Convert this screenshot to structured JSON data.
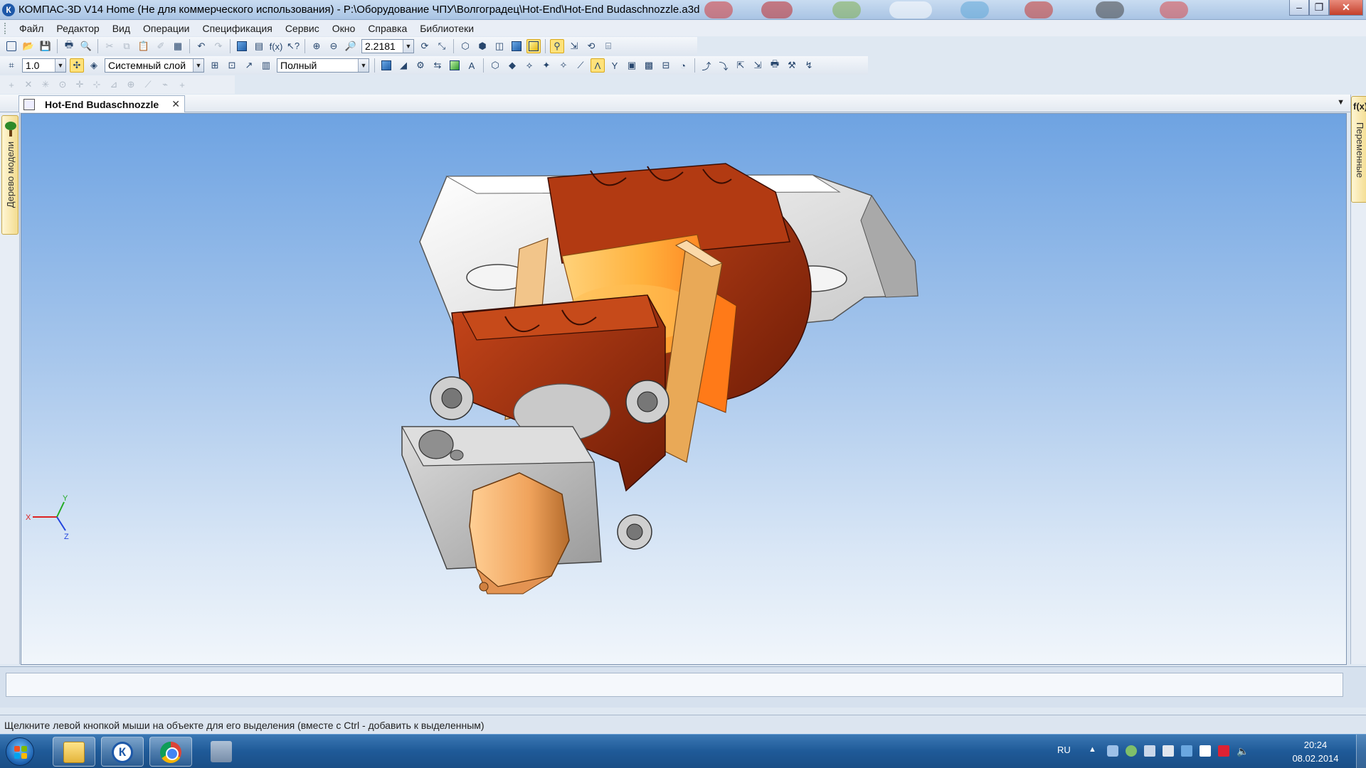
{
  "window": {
    "title": "КОМПАС-3D V14 Home (Не для коммерческого использования) - P:\\Оборудование ЧПУ\\Волгоградец\\Hot-End\\Hot-End Budaschnozzle.a3d",
    "app_icon_letter": "К"
  },
  "menu": [
    "Файл",
    "Редактор",
    "Вид",
    "Операции",
    "Спецификация",
    "Сервис",
    "Окно",
    "Справка",
    "Библиотеки"
  ],
  "toolbar1": {
    "zoom_value": "2.2181"
  },
  "toolbar2": {
    "step_value": "1.0",
    "layer_value": "Системный слой",
    "view_mode_value": "Полный"
  },
  "document_tab": {
    "label": "Hot-End Budaschnozzle"
  },
  "left_panel": {
    "model_tree_label": "Дерево модели"
  },
  "right_panel": {
    "variables_label": "Переменные",
    "fx_label": "f(x)"
  },
  "viewport": {
    "axis_labels": {
      "x": "X",
      "y": "Y",
      "z": "Z"
    },
    "colors": {
      "bracket": "#e6e6e6",
      "flange": "#8f2a0b",
      "heater_core": "#ffb84d",
      "rods": "#e9a957",
      "block": "#c8c8c8",
      "nozzle": "#f0a35c"
    }
  },
  "statusbar": {
    "text": "Щелкните левой кнопкой мыши на объекте для его выделения (вместе с Ctrl - добавить к выделенным)"
  },
  "taskbar": {
    "apps": [
      "explorer-folder",
      "kompas",
      "chrome",
      "printer"
    ],
    "tray": {
      "language": "RU",
      "time": "20:24",
      "date": "08.02.2014"
    }
  }
}
